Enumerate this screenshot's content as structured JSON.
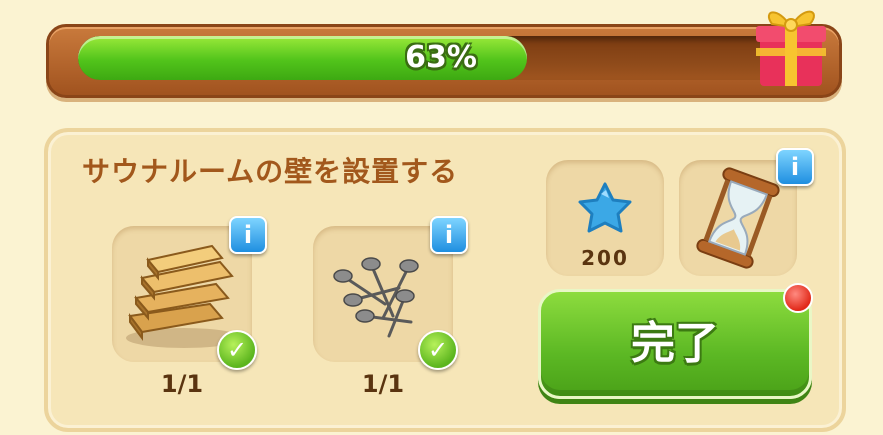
{
  "progress": {
    "percent_value": 0.63,
    "percent_text": "63%"
  },
  "quest": {
    "title": "サウナルームの壁を設置する"
  },
  "requirements": [
    {
      "icon": "wood-planks-icon",
      "count": "1/1",
      "complete": true,
      "info": "i"
    },
    {
      "icon": "nails-icon",
      "count": "1/1",
      "complete": true,
      "info": "i"
    }
  ],
  "rewards": {
    "stars": {
      "icon": "blue-star-icon",
      "amount": "200"
    },
    "hourglass": {
      "icon": "hourglass-icon",
      "info": "i"
    }
  },
  "complete_button": {
    "label": "完了"
  },
  "colors": {
    "accent_green": "#5cb824",
    "progress_frame": "#a1531f",
    "title_brown": "#a2581c",
    "info_blue": "#1f8fe0",
    "notification_red": "#e12a1a"
  },
  "icons": {
    "gift": "gift-box-icon",
    "check": "check-icon",
    "info": "info-icon",
    "notification": "notification-dot-icon"
  }
}
